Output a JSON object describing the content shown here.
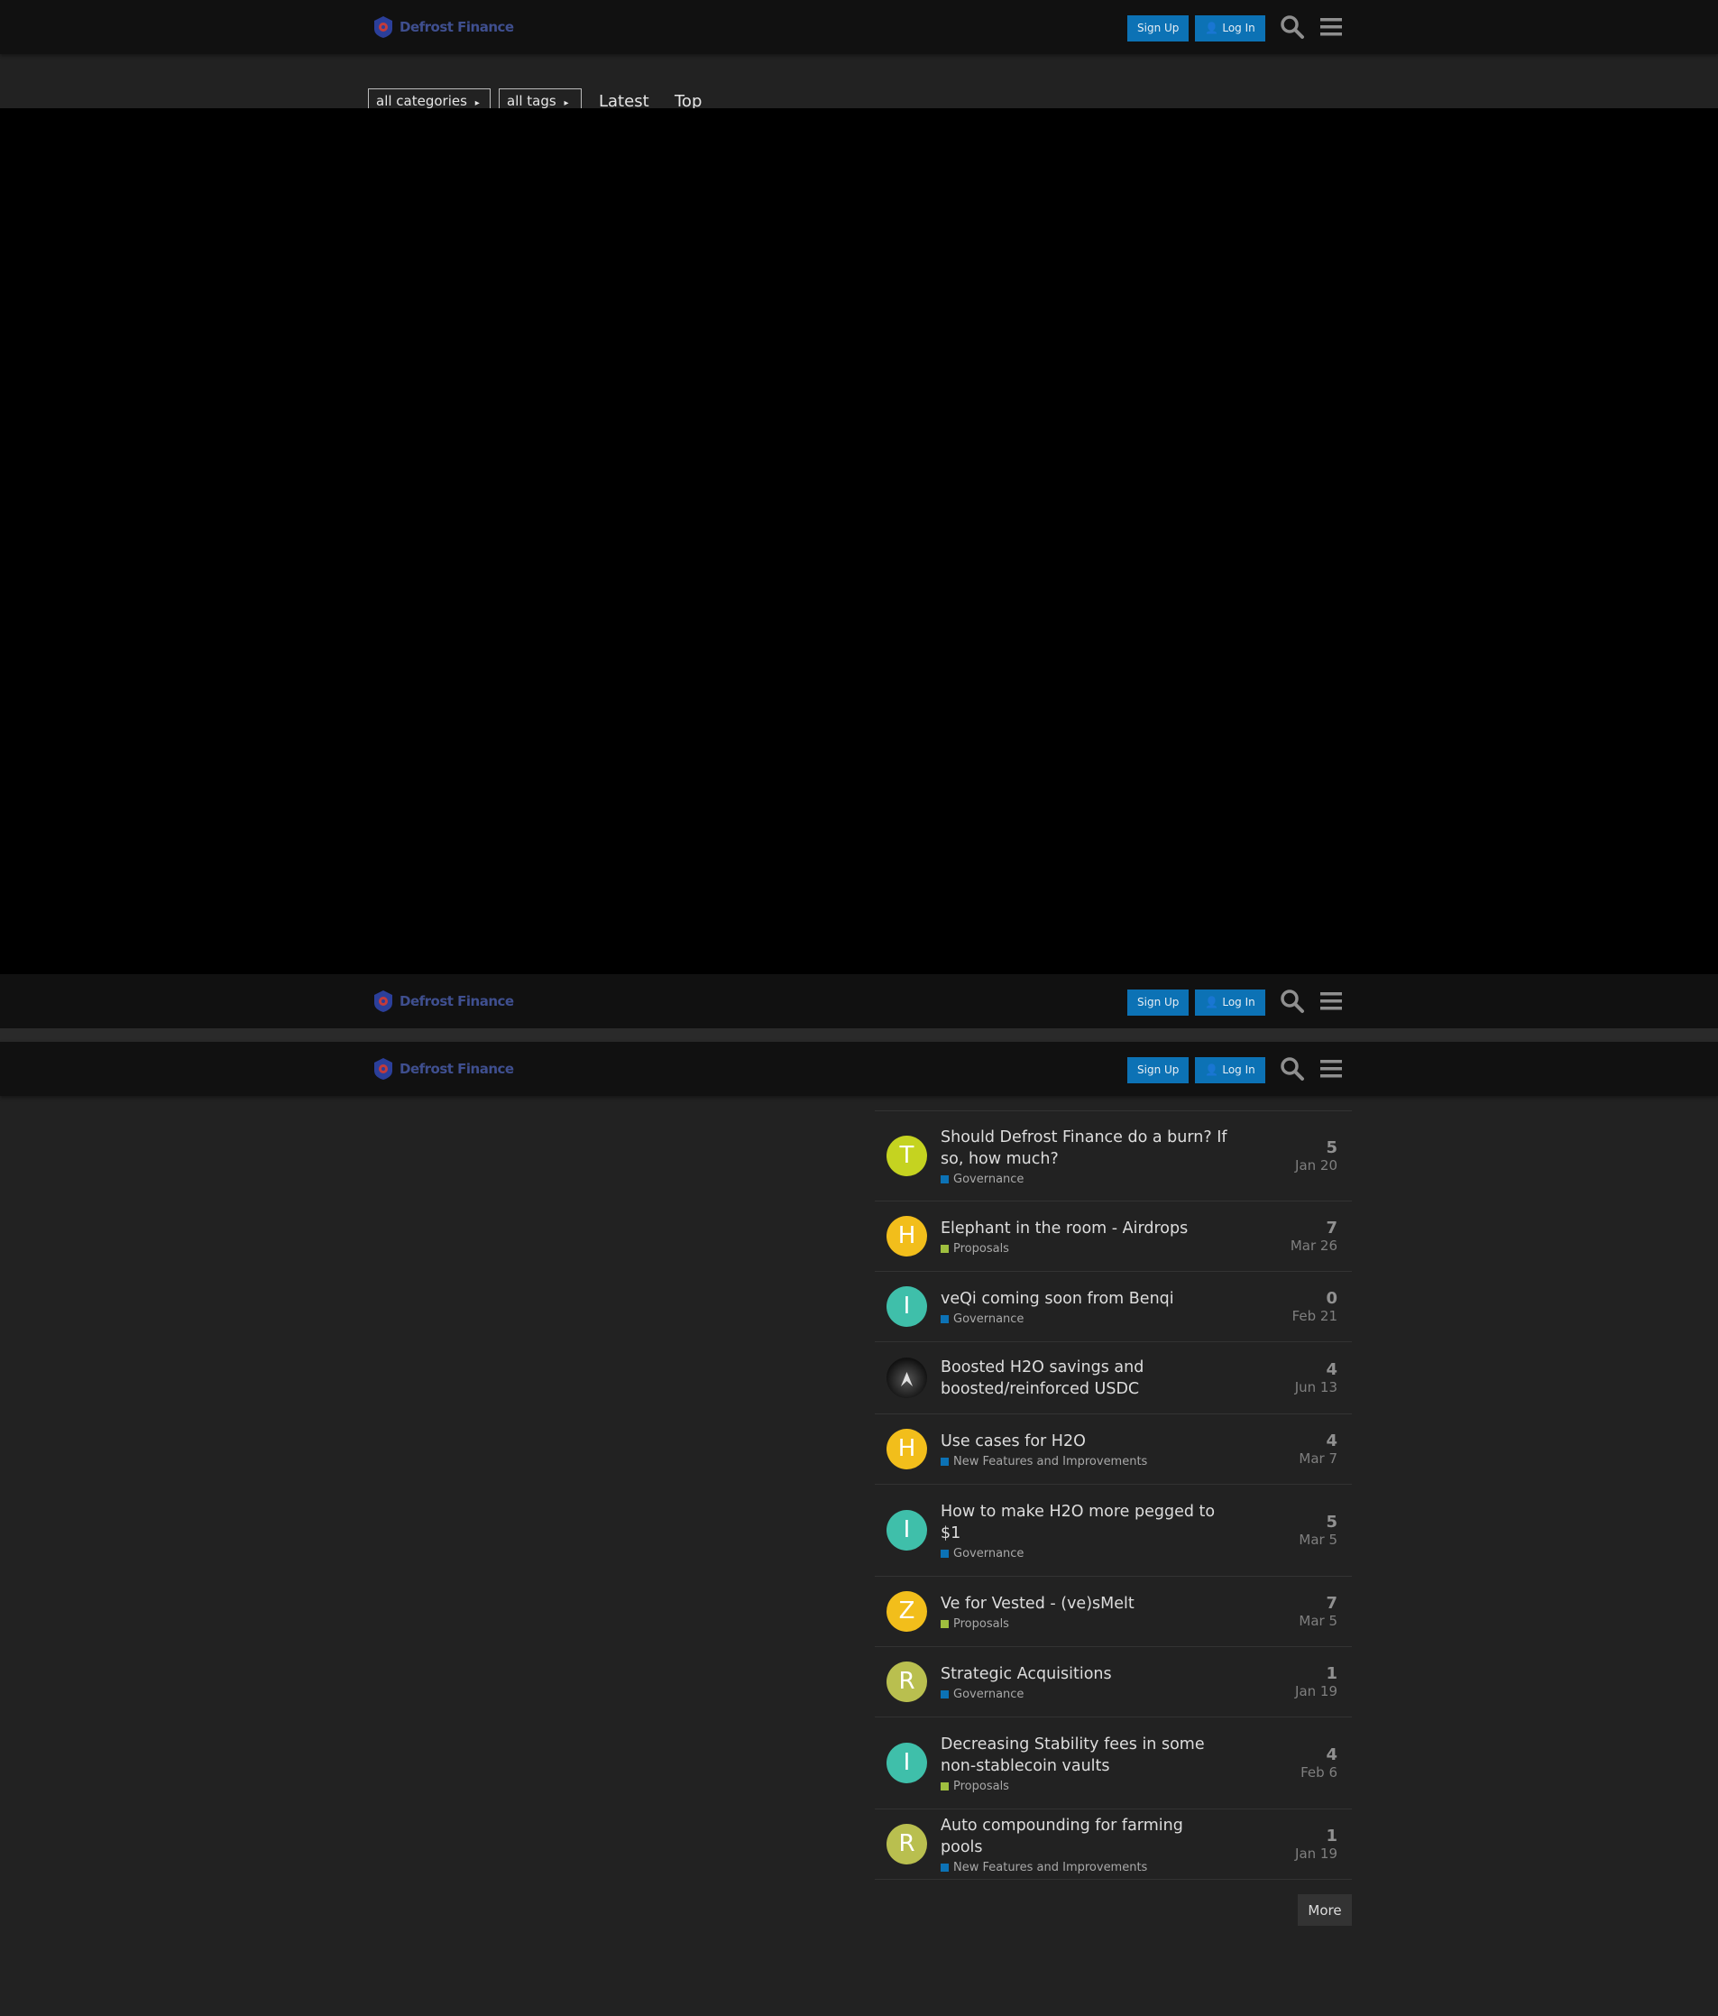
{
  "site": {
    "logo_text": "Defrost Finance",
    "signup_label": "Sign Up",
    "login_label": "Log In"
  },
  "nav": {
    "categories_label": "all categories",
    "tags_label": "all tags",
    "latest_label": "Latest",
    "top_label": "Top"
  },
  "topics": [
    {
      "avatar_letter": "T",
      "avatar_color": "#c5d320",
      "title_line1": "Should Defrost Finance do a burn? If",
      "title_line2": "so, how much?",
      "category": "Governance",
      "category_color": "#0c72b5",
      "replies": "5",
      "date": "Jan 20"
    },
    {
      "avatar_letter": "H",
      "avatar_color": "#f2be1b",
      "title_line1": "Elephant in the room - Airdrops",
      "title_line2": "",
      "category": "Proposals",
      "category_color": "#9fbf3f",
      "replies": "7",
      "date": "Mar 26"
    },
    {
      "avatar_letter": "I",
      "avatar_color": "#3fbfaa",
      "title_line1": "veQi coming soon from Benqi",
      "title_line2": "",
      "category": "Governance",
      "category_color": "#0c72b5",
      "replies": "0",
      "date": "Feb 21"
    },
    {
      "avatar_letter": "",
      "avatar_color": "#2a2a2a",
      "title_line1": "Boosted H2O savings and",
      "title_line2": "boosted/reinforced USDC",
      "category": "",
      "category_color": "",
      "replies": "4",
      "date": "Jun 13"
    },
    {
      "avatar_letter": "H",
      "avatar_color": "#f2be1b",
      "title_line1": "Use cases for H2O",
      "title_line2": "",
      "category": "New Features and Improvements",
      "category_color": "#0c72b5",
      "replies": "4",
      "date": "Mar 7"
    },
    {
      "avatar_letter": "I",
      "avatar_color": "#3fbfaa",
      "title_line1": "How to make H2O more pegged to",
      "title_line2": "$1",
      "category": "Governance",
      "category_color": "#0c72b5",
      "replies": "5",
      "date": "Mar 5"
    },
    {
      "avatar_letter": "Z",
      "avatar_color": "#f2be1b",
      "title_line1": "Ve for Vested - (ve)sMelt",
      "title_line2": "",
      "category": "Proposals",
      "category_color": "#9fbf3f",
      "replies": "7",
      "date": "Mar 5"
    },
    {
      "avatar_letter": "R",
      "avatar_color": "#b9bf4f",
      "title_line1": "Strategic Acquisitions",
      "title_line2": "",
      "category": "Governance",
      "category_color": "#0c72b5",
      "replies": "1",
      "date": "Jan 19"
    },
    {
      "avatar_letter": "I",
      "avatar_color": "#3fbfaa",
      "title_line1": "Decreasing Stability fees in some",
      "title_line2": "non-stablecoin vaults",
      "category": "Proposals",
      "category_color": "#9fbf3f",
      "replies": "4",
      "date": "Feb 6"
    },
    {
      "avatar_letter": "R",
      "avatar_color": "#b9bf4f",
      "title_line1": "Auto compounding for farming pools",
      "title_line2": "",
      "category": "New Features and Improvements",
      "category_color": "#0c72b5",
      "replies": "1",
      "date": "Jan 19"
    }
  ],
  "more_label": "More"
}
